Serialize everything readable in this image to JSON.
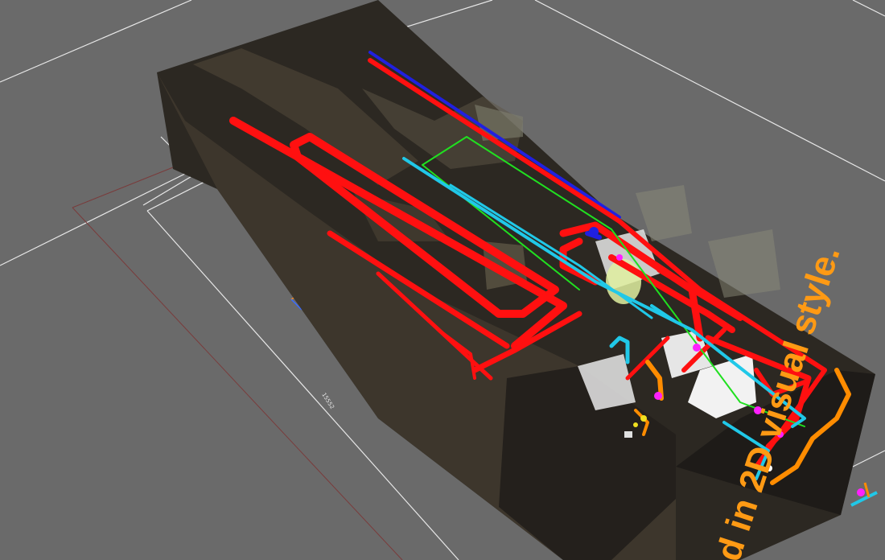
{
  "viewport": {
    "background": "#6a6a6a",
    "grid_color": "#e8e8e8",
    "reference_line_color": "#7a3b3b"
  },
  "dimension": {
    "value": "15552"
  },
  "model": {
    "pipe_colors": {
      "fire_main": "#ff1010",
      "hot_water": "#ff8c00",
      "chilled_water": "#20c8e8",
      "drain": "#2020e0",
      "signal": "#20e020",
      "valve": "#ff20ff",
      "fitting": "#f0e020"
    },
    "icons": [
      "point-cloud-building",
      "equipment-tank",
      "axis-gizmo"
    ]
  },
  "watermark": {
    "text": "d in 2D visual style."
  }
}
